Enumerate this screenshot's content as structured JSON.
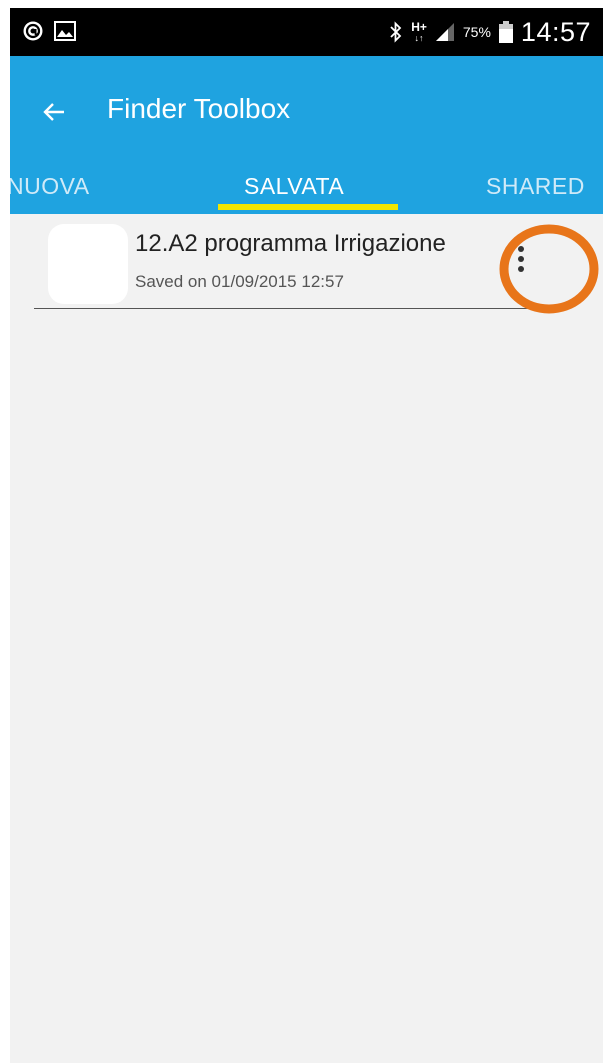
{
  "status_bar": {
    "left_icons": [
      "at-sign-icon",
      "image-icon"
    ],
    "right_icons": [
      "bluetooth-icon",
      "network-icon",
      "signal-icon",
      "battery-icon"
    ],
    "network_type": "H+",
    "battery_percent": "75%",
    "time": "14:57"
  },
  "app_bar": {
    "title": "Finder Toolbox",
    "color": "#1fa3e0"
  },
  "tabs": [
    {
      "label": "NUOVA",
      "selected": false
    },
    {
      "label": "SALVATA",
      "selected": true
    },
    {
      "label": "SHARED",
      "selected": false
    }
  ],
  "tab_indicator_color": "#f2e600",
  "list": {
    "items": [
      {
        "title": "12.A2   programma Irrigazione",
        "subtitle": "Saved on 01/09/2015 12:57"
      }
    ]
  },
  "annotation": {
    "highlight_color": "#e8751a"
  }
}
